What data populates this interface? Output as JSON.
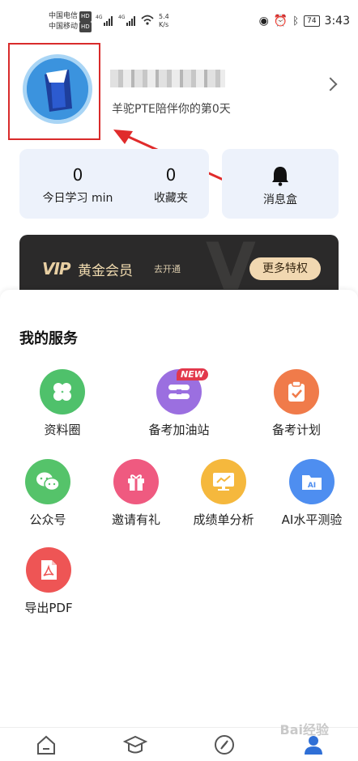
{
  "status_bar": {
    "carrier_1": "中国电信",
    "carrier_2": "中国移动",
    "hd": "HD",
    "speed_value": "5.4",
    "speed_unit": "K/s",
    "battery": "74",
    "time": "3:43"
  },
  "profile": {
    "tagline": "羊驼PTE陪伴你的第0天"
  },
  "stats": {
    "study_minutes": "0",
    "study_label": "今日学习 min",
    "favorites_count": "0",
    "favorites_label": "收藏夹",
    "messages_label": "消息盒"
  },
  "vip": {
    "logo_text": "VIP",
    "title": "黄金会员",
    "subtitle": "去开通",
    "more_button": "更多特权"
  },
  "services": {
    "title": "我的服务",
    "new_badge": "NEW",
    "items": [
      {
        "label": "资料圈",
        "icon": "clover-icon",
        "color": "#4fc16b"
      },
      {
        "label": "备考加油站",
        "icon": "station-icon",
        "color": "#9b6fe0"
      },
      {
        "label": "备考计划",
        "icon": "clipboard-check-icon",
        "color": "#f07b4a"
      },
      {
        "label": "公众号",
        "icon": "wechat-icon",
        "color": "#55c36a"
      },
      {
        "label": "邀请有礼",
        "icon": "gift-icon",
        "color": "#ef5a80"
      },
      {
        "label": "成绩单分析",
        "icon": "chart-board-icon",
        "color": "#f5b83d"
      },
      {
        "label": "AI水平测验",
        "icon": "ai-folder-icon",
        "color": "#4e8ef0"
      },
      {
        "label": "导出PDF",
        "icon": "pdf-icon",
        "color": "#ee5555"
      }
    ]
  },
  "bottom_nav": {
    "items": [
      "home-icon",
      "graduation-cap-icon",
      "compass-icon",
      "profile-icon"
    ]
  },
  "watermark": "Bai经验",
  "colors": {
    "highlight": "#d92b2b",
    "card_bg": "#edf2fb",
    "vip_bg": "#2b2a2a",
    "vip_button": "#f1d8b1"
  }
}
